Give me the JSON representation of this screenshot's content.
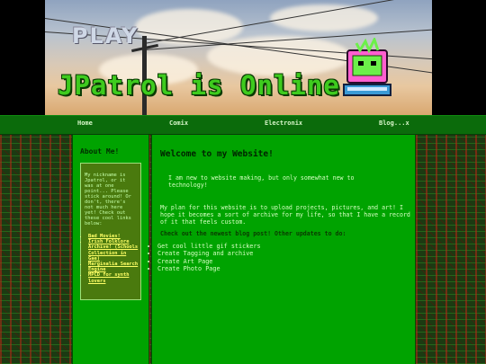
{
  "banner": {
    "play_text": "PLAY",
    "title": "JPatrol is Online"
  },
  "nav": {
    "items": [
      "Home",
      "Comix",
      "Electronix",
      "Blog...x"
    ]
  },
  "sidebar": {
    "heading": "About Me!",
    "intro": "My nickname is Jpatrol, or it was at one point... Please stick around! Or don't, there's not much here yet! Check out these cool links below:",
    "links": [
      "Bad Movies!",
      "Irish Folklore Archive! (Schools Collection in Gae)",
      "Marginalia Search Engine",
      "MPCD for synth lovers"
    ]
  },
  "main": {
    "heading": "Welcome to my Website!",
    "p1": "I am new to website making, but only somewhat new to technology!",
    "p2": "My plan for this website is to upload projects, pictures, and art! I hope it becomes a sort of archive for my life, so that I have a record of it that feels custom.",
    "p3": "Check out the newest blog post! Other updates to do:",
    "todo": [
      "Get cool little gif stickers",
      "Create Tagging and archive",
      "Create Art Page",
      "Create Photo Page"
    ]
  }
}
